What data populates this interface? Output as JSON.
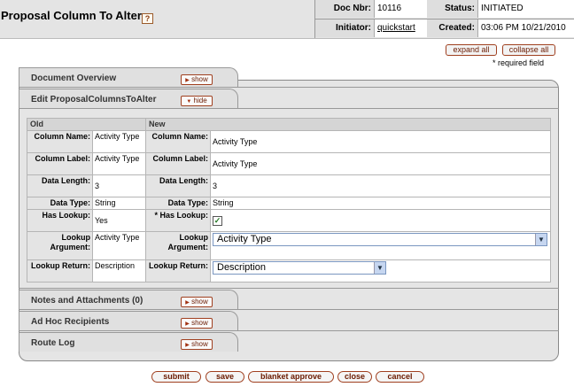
{
  "header": {
    "title": "Proposal Column To Alter",
    "help_glyph": "?",
    "doc_nbr_label": "Doc Nbr:",
    "doc_nbr_value": "10116",
    "status_label": "Status:",
    "status_value": "INITIATED",
    "initiator_label": "Initiator:",
    "initiator_value": "quickstart",
    "created_label": "Created:",
    "created_value": "03:06 PM 10/21/2010"
  },
  "toolbar": {
    "expand_all": "expand all",
    "collapse_all": "collapse all",
    "required_note": "* required field"
  },
  "tabs": {
    "document_overview": {
      "label": "Document Overview",
      "button": "show"
    },
    "edit": {
      "label": "Edit ProposalColumnsToAlter",
      "button": "hide"
    },
    "notes": {
      "label": "Notes and Attachments (0)",
      "button": "show"
    },
    "adhoc": {
      "label": "Ad Hoc Recipients",
      "button": "show"
    },
    "route_log": {
      "label": "Route Log",
      "button": "show"
    }
  },
  "edit_table": {
    "old_header": "Old",
    "new_header": "New",
    "rows": [
      {
        "label": "Column Name:",
        "old": "Activity Type",
        "new_label": "Column Name:",
        "new": "Activity Type"
      },
      {
        "label": "Column Label:",
        "old": "Activity Type",
        "new_label": "Column Label:",
        "new": "Activity Type"
      },
      {
        "label": "Data Length:",
        "old": "3",
        "new_label": "Data Length:",
        "new": "3"
      },
      {
        "label": "Data Type:",
        "old": "String",
        "new_label": "Data Type:",
        "new": "String"
      },
      {
        "label": "Has Lookup:",
        "old": "Yes",
        "new_label": "* Has Lookup:",
        "new_checked": true,
        "check_glyph": "✓"
      },
      {
        "label": "Lookup Argument:",
        "old": "Activity Type",
        "new_label": "Lookup Argument:",
        "new": "Activity Type"
      },
      {
        "label": "Lookup Return:",
        "old": "Description",
        "new_label": "Lookup Return:",
        "new": "Description"
      }
    ]
  },
  "buttons": {
    "submit": "submit",
    "save": "save",
    "blanket_approve": "blanket approve",
    "close": "close",
    "cancel": "cancel"
  }
}
